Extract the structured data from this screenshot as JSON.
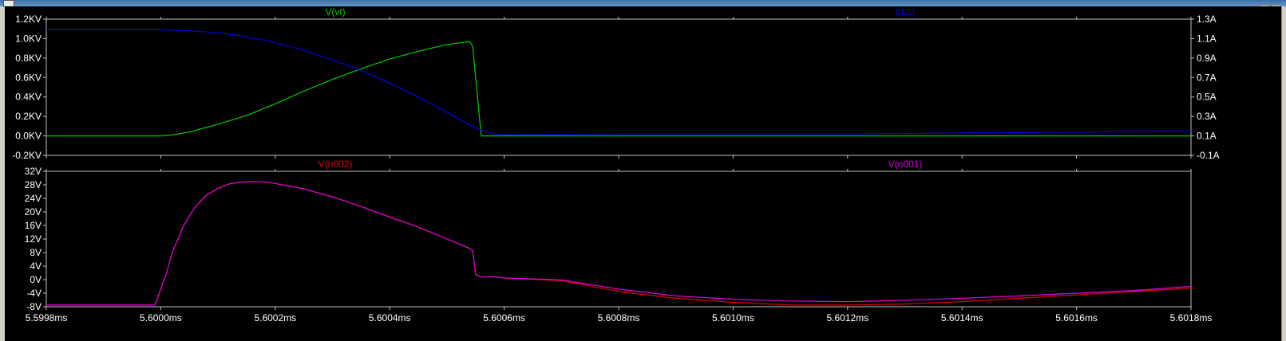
{
  "window": {
    "title": "",
    "background": "#000000",
    "axis_color": "#c0c0c0",
    "tick_text_color": "#ffffff"
  },
  "chart_data": [
    {
      "type": "line",
      "title": "",
      "xlabel": "",
      "ylabel": "",
      "x_unit": "ms",
      "xlim": [
        5.5998,
        5.6018
      ],
      "x_ticks": [
        5.5998,
        5.6,
        5.6002,
        5.6004,
        5.6006,
        5.6008,
        5.601,
        5.6012,
        5.6014,
        5.6016,
        5.6018
      ],
      "x_tick_labels": [
        "5.5998ms",
        "5.6000ms",
        "5.6002ms",
        "5.6004ms",
        "5.6006ms",
        "5.6008ms",
        "5.6010ms",
        "5.6012ms",
        "5.6014ms",
        "5.6016ms",
        "5.6018ms"
      ],
      "left_axis": {
        "unit": "KV",
        "ylim": [
          -0.2,
          1.2
        ],
        "ticks": [
          1.2,
          1.0,
          0.8,
          0.6,
          0.4,
          0.2,
          0.0,
          -0.2
        ],
        "tick_labels": [
          "1.2KV",
          "1.0KV",
          "0.8KV",
          "0.6KV",
          "0.4KV",
          "0.2KV",
          "0.0KV",
          "-0.2KV"
        ]
      },
      "right_axis": {
        "unit": "A",
        "ylim": [
          -0.1,
          1.3
        ],
        "ticks": [
          1.3,
          1.1,
          0.9,
          0.7,
          0.5,
          0.3,
          0.1,
          -0.1
        ],
        "tick_labels": [
          "1.3A",
          "1.1A",
          "0.9A",
          "0.7A",
          "0.5A",
          "0.3A",
          "0.1A",
          "-0.1A"
        ]
      },
      "series": [
        {
          "name": "V(vt)",
          "axis": "left",
          "color": "#00d000",
          "x": [
            5.5998,
            5.59995,
            5.6,
            5.60002,
            5.60005,
            5.6001,
            5.60015,
            5.6002,
            5.60025,
            5.6003,
            5.60035,
            5.6004,
            5.60045,
            5.6005,
            5.60054,
            5.600545,
            5.60055,
            5.60056,
            5.6006,
            5.6008,
            5.601,
            5.6012,
            5.6014,
            5.6016,
            5.6018
          ],
          "y": [
            0.0,
            0.0,
            0.0,
            0.01,
            0.04,
            0.12,
            0.21,
            0.33,
            0.46,
            0.58,
            0.69,
            0.79,
            0.87,
            0.94,
            0.97,
            0.92,
            0.6,
            0.0,
            0.0,
            0.0,
            0.0,
            0.0,
            0.0,
            0.0,
            0.0
          ]
        },
        {
          "name": "I(L1)",
          "axis": "right",
          "color": "#0000e0",
          "x": [
            5.5998,
            5.59995,
            5.6,
            5.60005,
            5.6001,
            5.60015,
            5.6002,
            5.60025,
            5.6003,
            5.60035,
            5.6004,
            5.60045,
            5.6005,
            5.60055,
            5.60058,
            5.6006,
            5.6008,
            5.601,
            5.6012,
            5.6014,
            5.6016,
            5.6018
          ],
          "y": [
            1.19,
            1.19,
            1.19,
            1.18,
            1.16,
            1.12,
            1.06,
            0.98,
            0.88,
            0.77,
            0.64,
            0.5,
            0.34,
            0.18,
            0.12,
            0.11,
            0.12,
            0.12,
            0.12,
            0.13,
            0.14,
            0.15
          ]
        }
      ]
    },
    {
      "type": "line",
      "title": "",
      "xlabel": "",
      "ylabel": "",
      "x_unit": "ms",
      "xlim": [
        5.5998,
        5.6018
      ],
      "x_ticks": [
        5.5998,
        5.6,
        5.6002,
        5.6004,
        5.6006,
        5.6008,
        5.601,
        5.6012,
        5.6014,
        5.6016,
        5.6018
      ],
      "x_tick_labels": [
        "5.5998ms",
        "5.6000ms",
        "5.6002ms",
        "5.6004ms",
        "5.6006ms",
        "5.6008ms",
        "5.6010ms",
        "5.6012ms",
        "5.6014ms",
        "5.6016ms",
        "5.6018ms"
      ],
      "left_axis": {
        "unit": "V",
        "ylim": [
          -8,
          32
        ],
        "ticks": [
          32,
          28,
          24,
          20,
          16,
          12,
          8,
          4,
          0,
          -4,
          -8
        ],
        "tick_labels": [
          "32V",
          "28V",
          "24V",
          "20V",
          "16V",
          "12V",
          "8V",
          "4V",
          "0V",
          "-4V",
          "-8V"
        ]
      },
      "series": [
        {
          "name": "V(n002)",
          "color": "#e00000",
          "x": [
            5.5998,
            5.59995,
            5.59999,
            5.60001,
            5.60002,
            5.60004,
            5.60006,
            5.60008,
            5.6001,
            5.60012,
            5.60014,
            5.60016,
            5.60018,
            5.6002,
            5.60025,
            5.6003,
            5.60035,
            5.6004,
            5.60045,
            5.6005,
            5.60054,
            5.600545,
            5.60055,
            5.60056,
            5.60058,
            5.6006,
            5.6007,
            5.6008,
            5.6009,
            5.601,
            5.6011,
            5.6012,
            5.6013,
            5.6014,
            5.6015,
            5.6016,
            5.6017,
            5.6018
          ],
          "y": [
            -7.5,
            -7.5,
            -7.5,
            2.0,
            8.0,
            16.0,
            21.5,
            25.0,
            27.0,
            28.3,
            28.8,
            29.0,
            28.9,
            28.4,
            26.8,
            24.5,
            21.6,
            18.5,
            15.5,
            12.0,
            9.2,
            8.5,
            1.5,
            0.8,
            0.9,
            0.5,
            -0.3,
            -3.5,
            -5.5,
            -6.7,
            -7.5,
            -7.5,
            -7.2,
            -6.5,
            -5.5,
            -4.5,
            -3.5,
            -2.5
          ]
        },
        {
          "name": "V(n001)",
          "color": "#e000e0",
          "x": [
            5.5998,
            5.59995,
            5.59999,
            5.60001,
            5.60002,
            5.60004,
            5.60006,
            5.60008,
            5.6001,
            5.60012,
            5.60014,
            5.60016,
            5.60018,
            5.6002,
            5.60025,
            5.6003,
            5.60035,
            5.6004,
            5.60045,
            5.6005,
            5.60054,
            5.600545,
            5.60055,
            5.60056,
            5.60058,
            5.6006,
            5.6007,
            5.6008,
            5.6009,
            5.601,
            5.6011,
            5.6012,
            5.6013,
            5.6014,
            5.6015,
            5.6016,
            5.6017,
            5.6018
          ],
          "y": [
            -7.5,
            -7.5,
            -7.5,
            2.0,
            8.0,
            16.0,
            21.5,
            25.0,
            27.0,
            28.3,
            28.8,
            29.0,
            28.9,
            28.4,
            26.8,
            24.5,
            21.6,
            18.5,
            15.5,
            12.0,
            9.2,
            8.5,
            1.5,
            0.8,
            0.9,
            0.5,
            -0.1,
            -2.8,
            -4.8,
            -5.8,
            -6.3,
            -6.5,
            -6.1,
            -5.5,
            -4.8,
            -4.0,
            -3.2,
            -2.0
          ]
        }
      ]
    }
  ]
}
